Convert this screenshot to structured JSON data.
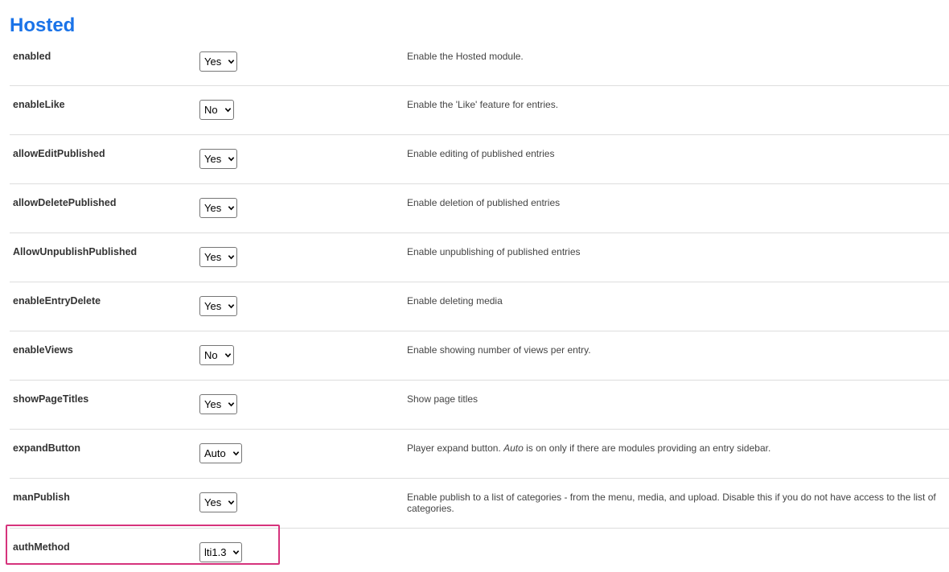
{
  "page": {
    "title": "Hosted"
  },
  "settings": [
    {
      "name": "enabled",
      "value": "Yes",
      "description": "Enable the Hosted module."
    },
    {
      "name": "enableLike",
      "value": "No",
      "description": "Enable the 'Like' feature for entries."
    },
    {
      "name": "allowEditPublished",
      "value": "Yes",
      "description": "Enable editing of published entries"
    },
    {
      "name": "allowDeletePublished",
      "value": "Yes",
      "description": "Enable deletion of published entries"
    },
    {
      "name": "AllowUnpublishPublished",
      "value": "Yes",
      "description": "Enable unpublishing of published entries"
    },
    {
      "name": "enableEntryDelete",
      "value": "Yes",
      "description": "Enable deleting media"
    },
    {
      "name": "enableViews",
      "value": "No",
      "description": "Enable showing number of views per entry."
    },
    {
      "name": "showPageTitles",
      "value": "Yes",
      "description": "Show page titles"
    },
    {
      "name": "expandButton",
      "value": "Auto",
      "description_prefix": "Player expand button. ",
      "description_em": "Auto",
      "description_suffix": " is on only if there are modules providing an entry sidebar."
    },
    {
      "name": "manPublish",
      "value": "Yes",
      "description": "Enable publish to a list of categories - from the menu, media, and upload. Disable this if you do not have access to the list of categories."
    },
    {
      "name": "authMethod",
      "value": "lti1.3",
      "description": ""
    }
  ],
  "highlight": {
    "color": "#d6337c",
    "target": "authMethod"
  },
  "colors": {
    "title": "#1a73e8",
    "divider": "#dddddd"
  },
  "icons": {
    "select_arrow": "chevron-down-icon"
  }
}
